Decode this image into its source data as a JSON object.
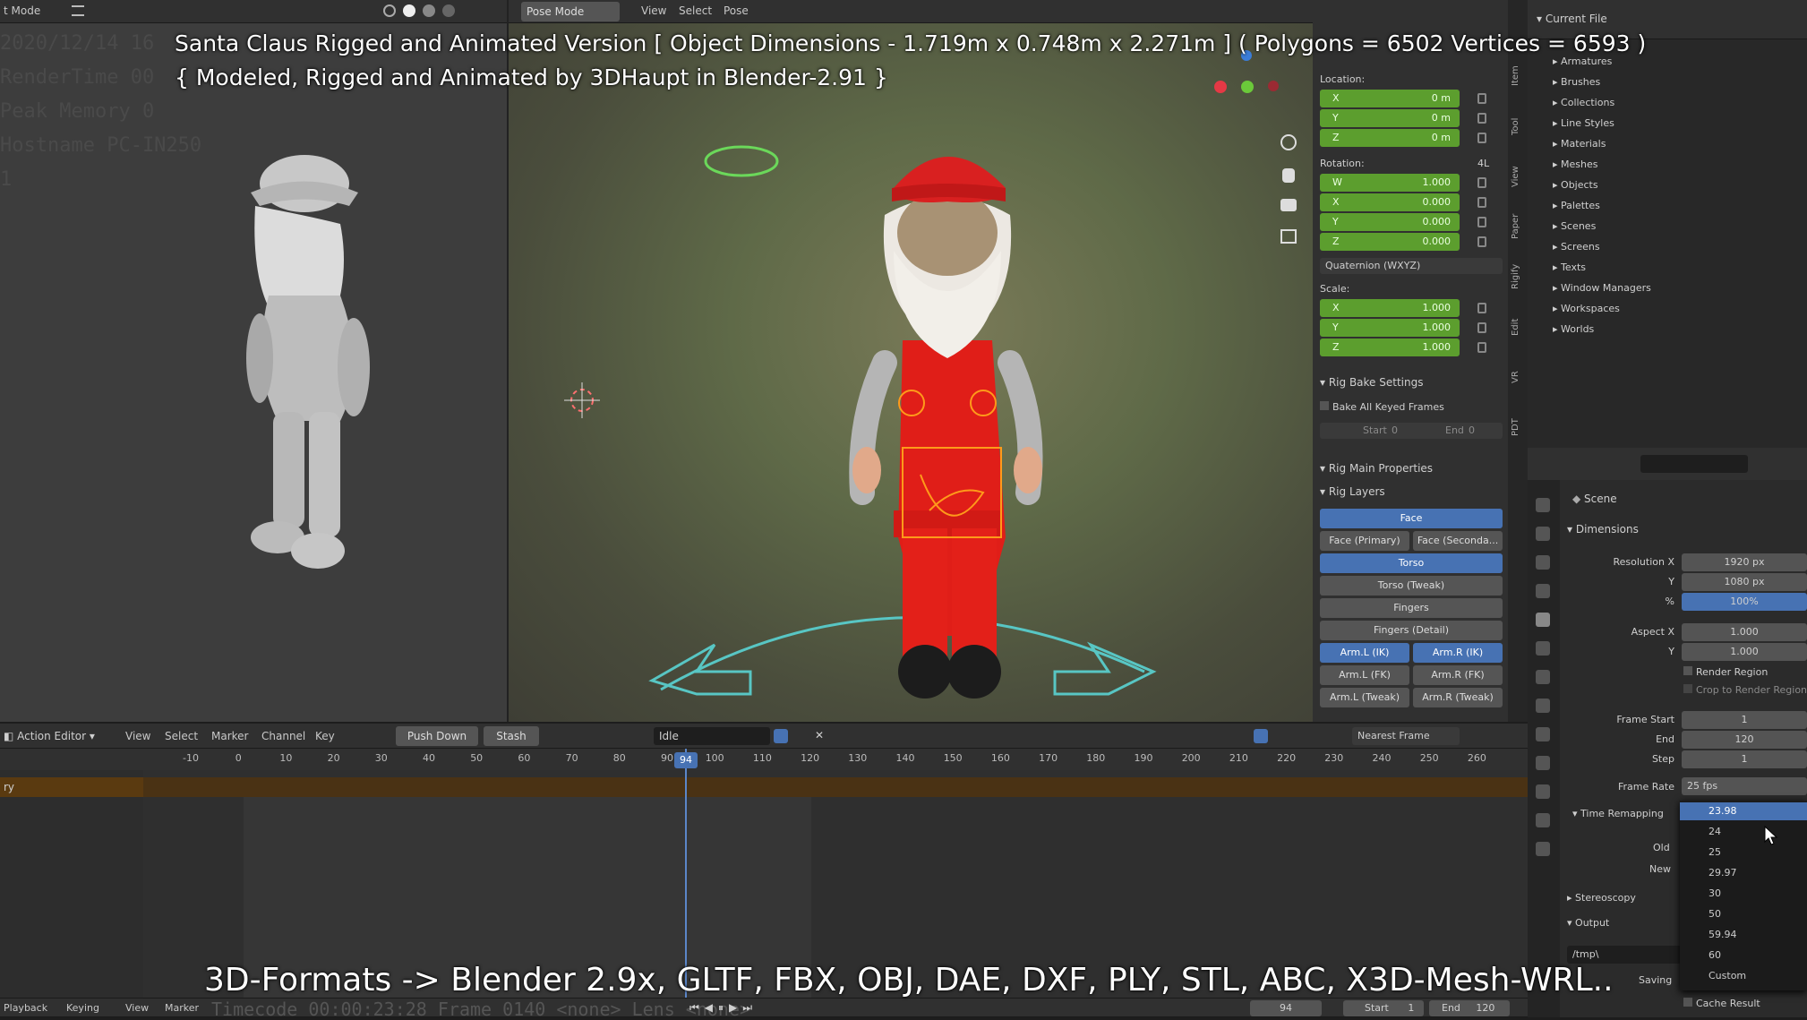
{
  "overlay": {
    "line1": "Santa Claus Rigged and Animated Version [ Object Dimensions -  1.719m x 0.748m x 2.271m ] ( Polygons = 6502  Vertices = 6593 )",
    "line2": "{ Modeled, Rigged and Animated by 3DHaupt in Blender-2.91 }",
    "bottom": "3D-Formats -> Blender 2.9x, GLTF, FBX, OBJ, DAE, DXF, PLY, STL, ABC, X3D-Mesh-WRL.."
  },
  "left_view": {
    "mode_label": "t Mode",
    "ghost_lines": [
      "2020/12/14 16",
      "RenderTime 00",
      "Peak Memory 0",
      "Hostname PC-IN250",
      "1"
    ]
  },
  "viewport": {
    "mode": "Pose Mode",
    "menus": [
      "View",
      "Select",
      "Pose"
    ]
  },
  "transform": {
    "location_label": "Location:",
    "location": [
      {
        "axis": "X",
        "value": "0 m"
      },
      {
        "axis": "Y",
        "value": "0 m"
      },
      {
        "axis": "Z",
        "value": "0 m"
      }
    ],
    "rotation_label": "Rotation:",
    "rotation_mode_short": "4L",
    "rotation": [
      {
        "axis": "W",
        "value": "1.000"
      },
      {
        "axis": "X",
        "value": "0.000"
      },
      {
        "axis": "Y",
        "value": "0.000"
      },
      {
        "axis": "Z",
        "value": "0.000"
      }
    ],
    "rotation_mode": "Quaternion (WXYZ)",
    "scale_label": "Scale:",
    "scale": [
      {
        "axis": "X",
        "value": "1.000"
      },
      {
        "axis": "Y",
        "value": "1.000"
      },
      {
        "axis": "Z",
        "value": "1.000"
      }
    ]
  },
  "rig": {
    "bake_title": "Rig Bake Settings",
    "bake_all": "Bake All Keyed Frames",
    "start_label": "Start",
    "start_value": "0",
    "end_label": "End",
    "end_value": "0",
    "main_props": "Rig Main Properties",
    "layers_title": "Rig Layers",
    "layers": [
      {
        "label": "Face",
        "on": true,
        "full": true
      },
      {
        "label": "Face (Primary)",
        "on": false,
        "full": false,
        "label2": "Face (Seconda...",
        "on2": false
      },
      {
        "label": "Torso",
        "on": true,
        "full": true
      },
      {
        "label": "Torso (Tweak)",
        "on": false,
        "full": true
      },
      {
        "label": "Fingers",
        "on": false,
        "full": true
      },
      {
        "label": "Fingers (Detail)",
        "on": false,
        "full": true
      },
      {
        "label": "Arm.L (IK)",
        "on": true,
        "full": false,
        "label2": "Arm.R (IK)",
        "on2": true
      },
      {
        "label": "Arm.L (FK)",
        "on": false,
        "full": false,
        "label2": "Arm.R (FK)",
        "on2": false
      },
      {
        "label": "Arm.L (Tweak)",
        "on": false,
        "full": false,
        "label2": "Arm.R (Tweak)",
        "on2": false
      }
    ]
  },
  "side_tabs": [
    "Item",
    "Tool",
    "View",
    "Paper",
    "Rigify",
    "Edit",
    "VR",
    "PDT"
  ],
  "outliner": {
    "title": "Current File",
    "items": [
      "Armatures",
      "Brushes",
      "Collections",
      "Line Styles",
      "Materials",
      "Meshes",
      "Objects",
      "Palettes",
      "Scenes",
      "Screens",
      "Texts",
      "Window Managers",
      "Workspaces",
      "Worlds"
    ]
  },
  "properties": {
    "scene_label": "Scene",
    "dimensions_title": "Dimensions",
    "rows": [
      {
        "label": "Resolution X",
        "value": "1920 px"
      },
      {
        "label": "Y",
        "value": "1080 px"
      },
      {
        "label": "%",
        "value": "100%"
      },
      {
        "label": "Aspect X",
        "value": "1.000"
      },
      {
        "label": "Y",
        "value": "1.000"
      }
    ],
    "render_region": "Render Region",
    "crop": "Crop to Render Region",
    "frame_rows": [
      {
        "label": "Frame Start",
        "value": "1"
      },
      {
        "label": "End",
        "value": "120"
      },
      {
        "label": "Step",
        "value": "1"
      }
    ],
    "frame_rate_label": "Frame Rate",
    "frame_rate_value": "25 fps",
    "time_remapping": "Time Remapping",
    "old_label": "Old",
    "new_label": "New",
    "stereoscopy": "Stereoscopy",
    "output": "Output",
    "output_path": "/tmp\\",
    "saving": "Saving",
    "cache_result": "Cache Result"
  },
  "fps_menu": {
    "selected": "23.98",
    "options": [
      "23.98",
      "24",
      "25",
      "29.97",
      "30",
      "50",
      "59.94",
      "60",
      "Custom"
    ]
  },
  "action_editor": {
    "mode": "Action Editor",
    "menus": [
      "View",
      "Select",
      "Marker",
      "Channel",
      "Key"
    ],
    "push_down": "Push Down",
    "stash": "Stash",
    "action_name": "Idle",
    "snap": "Nearest Frame",
    "current_frame": "94",
    "ruler": [
      "-10",
      "0",
      "10",
      "20",
      "30",
      "40",
      "50",
      "60",
      "70",
      "80",
      "90",
      "100",
      "110",
      "120",
      "130",
      "140",
      "150",
      "160",
      "170",
      "180",
      "190",
      "200",
      "210",
      "220",
      "230",
      "240",
      "250",
      "260"
    ],
    "channel": "ry"
  },
  "playback": {
    "menus": [
      "Playback",
      "Keying",
      "View",
      "Marker"
    ],
    "ghost": "Timecode 00:00:23:28     Frame 0140     <none>     Lens <none>",
    "current": "94",
    "start_label": "Start",
    "start": "1",
    "end_label": "End",
    "end": "120"
  }
}
